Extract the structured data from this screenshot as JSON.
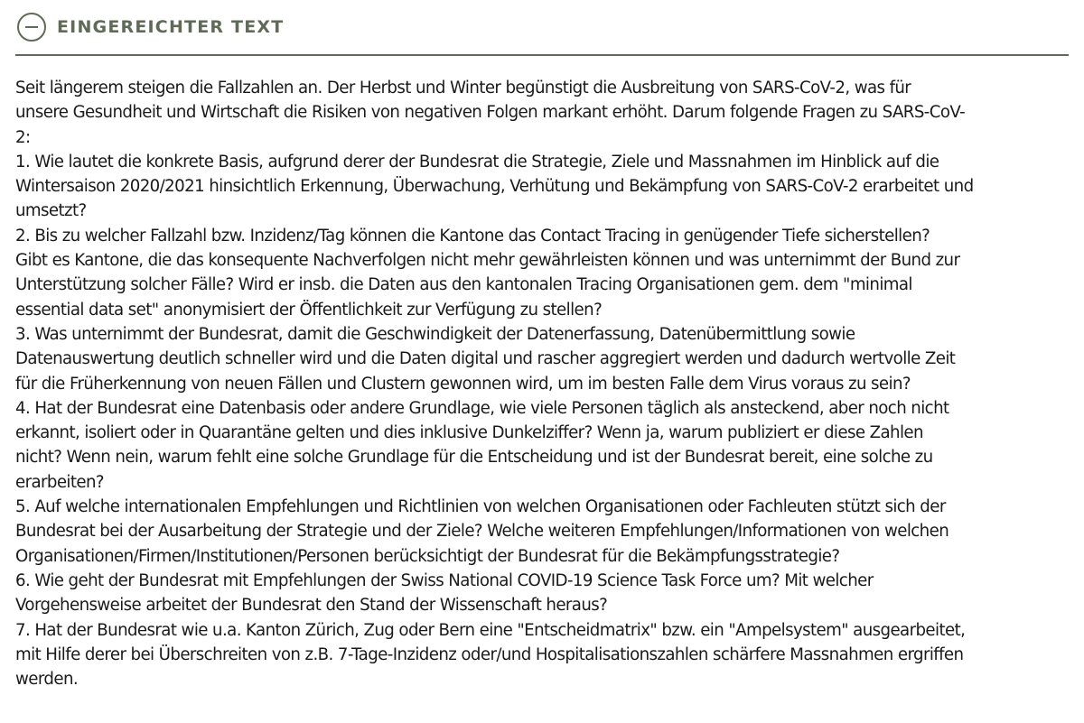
{
  "section": {
    "title": "EINGEREICHTER TEXT",
    "toggle_icon": "minus-circle-icon",
    "accent_color": "#5f6b56"
  },
  "submitted_text": {
    "lines": [
      "Seit längerem steigen die Fallzahlen an. Der Herbst und Winter begünstigt die Ausbreitung von SARS-CoV-2, was für",
      "unsere Gesundheit und Wirtschaft die Risiken von negativen Folgen markant erhöht. Darum folgende Fragen zu SARS-CoV-",
      "2:",
      "1. Wie lautet die konkrete Basis, aufgrund derer der Bundesrat die Strategie, Ziele und Massnahmen im Hinblick auf die",
      "Wintersaison 2020/2021 hinsichtlich Erkennung, Überwachung, Verhütung und Bekämpfung von SARS-CoV-2 erarbeitet und",
      "umsetzt?",
      "2. Bis zu welcher Fallzahl bzw. Inzidenz/Tag können die Kantone das Contact Tracing in genügender Tiefe sicherstellen?",
      "Gibt es Kantone, die das konsequente Nachverfolgen nicht mehr gewährleisten können und was unternimmt der Bund zur",
      "Unterstützung solcher Fälle? Wird er insb. die Daten aus den kantonalen Tracing Organisationen gem. dem \"minimal",
      "essential data set\" anonymisiert der Öffentlichkeit zur Verfügung zu stellen?",
      "3. Was unternimmt der Bundesrat, damit die Geschwindigkeit der Datenerfassung, Datenübermittlung sowie",
      "Datenauswertung deutlich schneller wird und die Daten digital und rascher aggregiert werden und dadurch wertvolle Zeit",
      "für die Früherkennung von neuen Fällen und Clustern gewonnen wird, um im besten Falle dem Virus voraus zu sein?",
      "4. Hat der Bundesrat eine Datenbasis oder andere Grundlage, wie viele Personen täglich als ansteckend, aber noch nicht",
      "erkannt, isoliert oder in Quarantäne gelten und dies inklusive Dunkelziffer? Wenn ja, warum publiziert er diese Zahlen",
      "nicht? Wenn nein, warum fehlt eine solche Grundlage für die Entscheidung und ist der Bundesrat bereit, eine solche zu",
      "erarbeiten?",
      "5. Auf welche internationalen Empfehlungen und Richtlinien von welchen Organisationen oder Fachleuten stützt sich der",
      "Bundesrat bei der Ausarbeitung der Strategie und der Ziele? Welche weiteren Empfehlungen/Informationen von welchen",
      "Organisationen/Firmen/Institutionen/Personen berücksichtigt der Bundesrat für die Bekämpfungsstrategie?",
      "6. Wie geht der Bundesrat mit Empfehlungen der Swiss National COVID-19 Science Task Force um? Mit welcher",
      "Vorgehensweise arbeitet der Bundesrat den Stand der Wissenschaft heraus?",
      "7. Hat der Bundesrat wie u.a. Kanton Zürich, Zug oder Bern eine \"Entscheidmatrix\" bzw. ein \"Ampelsystem\" ausgearbeitet,",
      "mit Hilfe derer bei Überschreiten von z.B. 7-Tage-Inzidenz oder/und Hospitalisationszahlen schärfere Massnahmen ergriffen",
      "werden."
    ]
  }
}
